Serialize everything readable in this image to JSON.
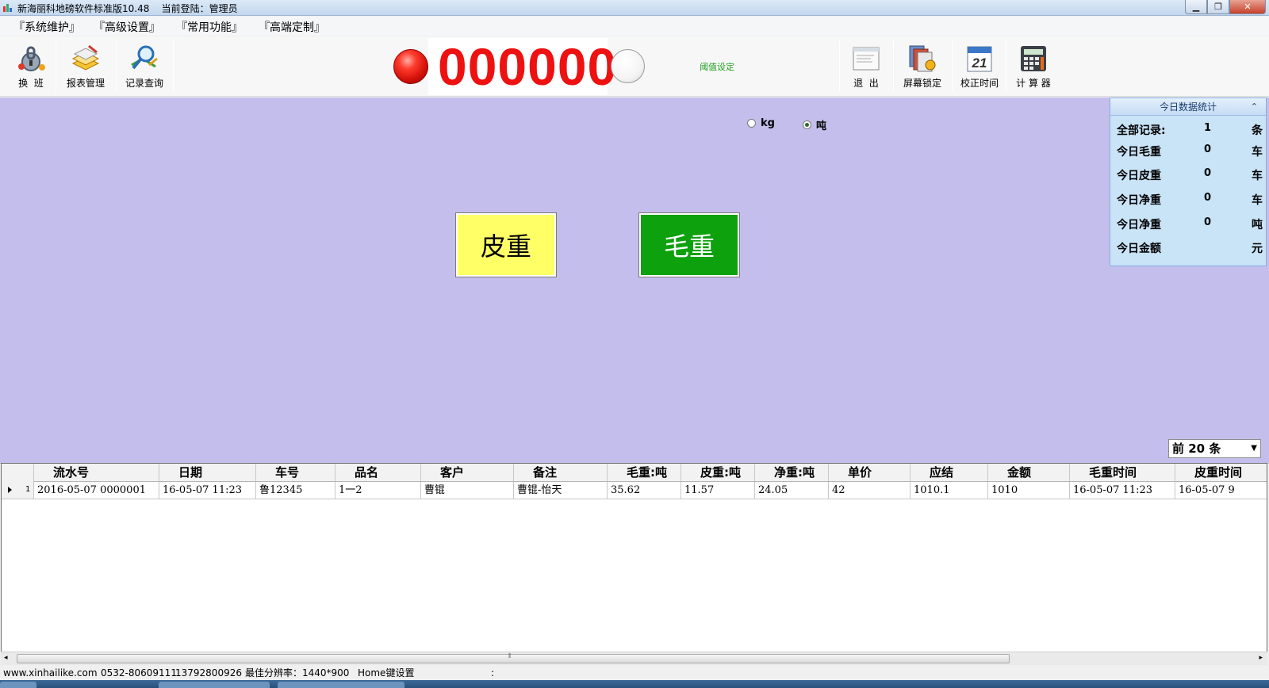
{
  "window": {
    "title": "新海丽科地磅软件标准版10.48    当前登陆：管理员",
    "buttons": {
      "minimize": "▁",
      "maximize": "❐",
      "close": "✕"
    }
  },
  "menu": [
    "『系统维护』",
    "『高级设置』",
    "『常用功能』",
    "『高端定制』"
  ],
  "toolbar": {
    "left_tools": [
      {
        "label": "换  班",
        "icon": "lock-key-icon"
      },
      {
        "label": "报表管理",
        "icon": "books-icon"
      },
      {
        "label": "记录查询",
        "icon": "magnifier-icon"
      }
    ],
    "weight_display": "000000",
    "threshold_label": "阈值设定",
    "right_tools": [
      {
        "label": "退  出",
        "icon": "exit-document-icon"
      },
      {
        "label": "屏幕锁定",
        "icon": "screen-lock-icon"
      },
      {
        "label": "校正时间",
        "icon": "calendar-icon",
        "day": "21"
      },
      {
        "label": "计 算 器",
        "icon": "calculator-icon"
      }
    ]
  },
  "units": {
    "options": [
      "kg",
      "吨"
    ],
    "selected": "吨"
  },
  "actions": {
    "tare": "皮重",
    "gross": "毛重"
  },
  "stats": {
    "title": "今日数据统计",
    "collapse_icon": "⌃",
    "rows": [
      {
        "label": "全部记录:",
        "value": "1",
        "unit": "条"
      },
      {
        "label": "今日毛重",
        "value": "0",
        "unit": "车"
      },
      {
        "label": "今日皮重",
        "value": "0",
        "unit": "车"
      },
      {
        "label": "今日净重",
        "value": "0",
        "unit": "车"
      },
      {
        "label": "今日净重",
        "value": "0",
        "unit": "吨"
      },
      {
        "label": "今日金额",
        "value": "",
        "unit": "元"
      }
    ]
  },
  "record_filter": "前 20 条",
  "table": {
    "columns": [
      "流水号",
      "日期",
      "车号",
      "品名",
      "客户",
      "备注",
      "毛重:吨",
      "皮重:吨",
      "净重:吨",
      "单价",
      "应结",
      "金额",
      "毛重时间",
      "皮重时间"
    ],
    "rows": [
      {
        "index": "1",
        "cells": [
          "2016-05-07 0000001",
          "16-05-07 11:23",
          "鲁12345",
          "1一2",
          "曹锟",
          "曹锟-怡天",
          "35.62",
          "11.57",
          "24.05",
          "42",
          "1010.1",
          "1010",
          "16-05-07 11:23",
          "16-05-07 9"
        ]
      }
    ]
  },
  "scroll_grip": "⦀",
  "status": {
    "website": "www.xinhailike.com",
    "phone1": "0532-80609111",
    "phone2": "13792800926",
    "resolution": "最佳分辨率：1440*900",
    "home_key": "Home键设置",
    "colon": ":"
  },
  "colors": {
    "work_area": "#c4beec",
    "tare_button": "#ffff66",
    "gross_button": "#0ea10e",
    "weight_digits": "#ee1111",
    "stats_panel": "#c9e3f7"
  }
}
